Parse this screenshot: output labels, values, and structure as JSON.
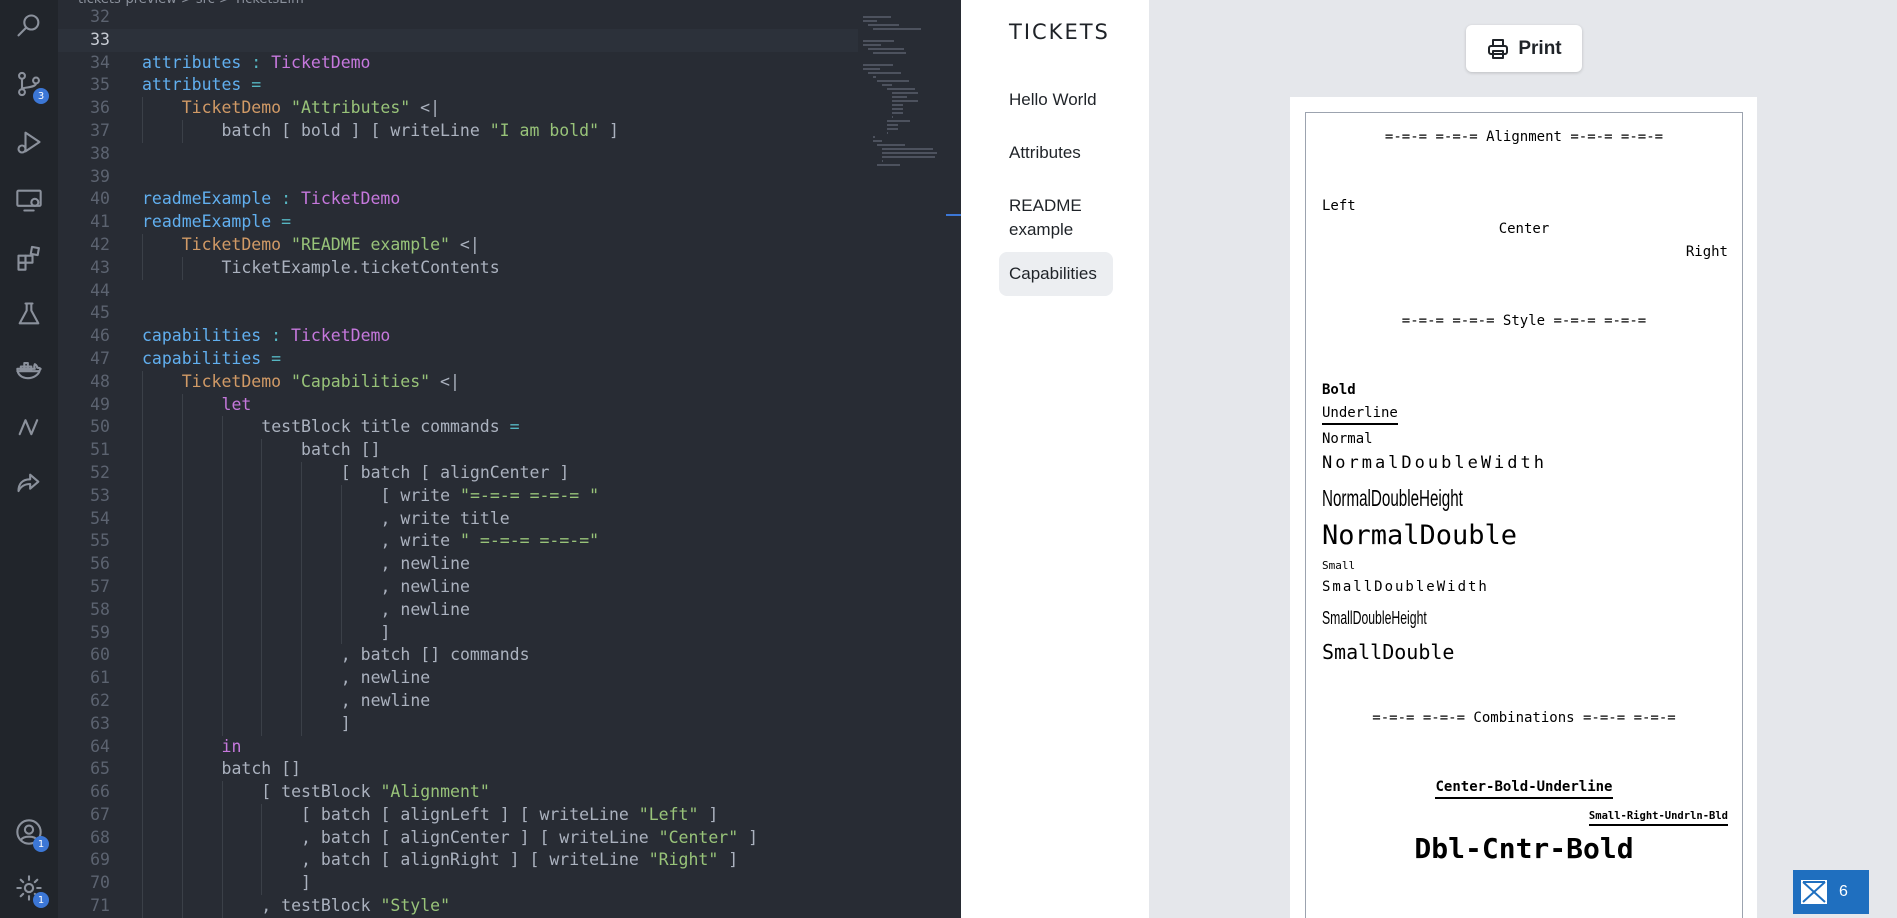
{
  "breadcrumb": "tickets-preview  >  src  >  TicketsElm",
  "activity_bar": {
    "source_control_badge": "3",
    "accounts_badge": "1",
    "settings_badge": "1"
  },
  "code_lines": [
    {
      "n": "32",
      "indent": 0,
      "tokens": []
    },
    {
      "n": "33",
      "indent": 0,
      "current": true,
      "tokens": []
    },
    {
      "n": "34",
      "indent": 0,
      "tokens": [
        [
          "fn",
          "attributes"
        ],
        [
          "op",
          " : "
        ],
        [
          "ty",
          "TicketDemo"
        ]
      ]
    },
    {
      "n": "35",
      "indent": 0,
      "tokens": [
        [
          "fn",
          "attributes"
        ],
        [
          "op",
          " ="
        ]
      ]
    },
    {
      "n": "36",
      "indent": 1,
      "tokens": [
        [
          "ctor2",
          "TicketDemo"
        ],
        [
          "pl",
          " "
        ],
        [
          "str",
          "\"Attributes\""
        ],
        [
          "pl",
          " <|"
        ]
      ]
    },
    {
      "n": "37",
      "indent": 2,
      "tokens": [
        [
          "pl",
          "batch [ bold ] [ writeLine "
        ],
        [
          "str",
          "\"I am bold\""
        ],
        [
          "pl",
          " ]"
        ]
      ]
    },
    {
      "n": "38",
      "indent": 0,
      "tokens": []
    },
    {
      "n": "39",
      "indent": 0,
      "tokens": []
    },
    {
      "n": "40",
      "indent": 0,
      "tokens": [
        [
          "fn",
          "readmeExample"
        ],
        [
          "op",
          " : "
        ],
        [
          "ty",
          "TicketDemo"
        ]
      ]
    },
    {
      "n": "41",
      "indent": 0,
      "tokens": [
        [
          "fn",
          "readmeExample"
        ],
        [
          "op",
          " ="
        ]
      ]
    },
    {
      "n": "42",
      "indent": 1,
      "tokens": [
        [
          "ctor2",
          "TicketDemo"
        ],
        [
          "pl",
          " "
        ],
        [
          "str",
          "\"README example\""
        ],
        [
          "pl",
          " <|"
        ]
      ]
    },
    {
      "n": "43",
      "indent": 2,
      "tokens": [
        [
          "pl",
          "TicketExample.ticketContents"
        ]
      ]
    },
    {
      "n": "44",
      "indent": 0,
      "tokens": []
    },
    {
      "n": "45",
      "indent": 0,
      "tokens": []
    },
    {
      "n": "46",
      "indent": 0,
      "tokens": [
        [
          "fn",
          "capabilities"
        ],
        [
          "op",
          " : "
        ],
        [
          "ty",
          "TicketDemo"
        ]
      ]
    },
    {
      "n": "47",
      "indent": 0,
      "tokens": [
        [
          "fn",
          "capabilities"
        ],
        [
          "op",
          " ="
        ]
      ]
    },
    {
      "n": "48",
      "indent": 1,
      "tokens": [
        [
          "ctor2",
          "TicketDemo"
        ],
        [
          "pl",
          " "
        ],
        [
          "str",
          "\"Capabilities\""
        ],
        [
          "pl",
          " <|"
        ]
      ]
    },
    {
      "n": "49",
      "indent": 2,
      "tokens": [
        [
          "kw",
          "let"
        ]
      ]
    },
    {
      "n": "50",
      "indent": 3,
      "tokens": [
        [
          "pl",
          "testBlock title commands "
        ],
        [
          "op",
          "="
        ]
      ]
    },
    {
      "n": "51",
      "indent": 4,
      "tokens": [
        [
          "pl",
          "batch []"
        ]
      ]
    },
    {
      "n": "52",
      "indent": 5,
      "tokens": [
        [
          "pl",
          "[ batch [ alignCenter ]"
        ]
      ]
    },
    {
      "n": "53",
      "indent": 6,
      "tokens": [
        [
          "pl",
          "[ write "
        ],
        [
          "str",
          "\"=-=-= =-=-= \""
        ]
      ]
    },
    {
      "n": "54",
      "indent": 6,
      "tokens": [
        [
          "pl",
          ", write title"
        ]
      ]
    },
    {
      "n": "55",
      "indent": 6,
      "tokens": [
        [
          "pl",
          ", write "
        ],
        [
          "str",
          "\" =-=-= =-=-=\""
        ]
      ]
    },
    {
      "n": "56",
      "indent": 6,
      "tokens": [
        [
          "pl",
          ", newline"
        ]
      ]
    },
    {
      "n": "57",
      "indent": 6,
      "tokens": [
        [
          "pl",
          ", newline"
        ]
      ]
    },
    {
      "n": "58",
      "indent": 6,
      "tokens": [
        [
          "pl",
          ", newline"
        ]
      ]
    },
    {
      "n": "59",
      "indent": 6,
      "tokens": [
        [
          "pl",
          "]"
        ]
      ]
    },
    {
      "n": "60",
      "indent": 5,
      "tokens": [
        [
          "pl",
          ", batch [] commands"
        ]
      ]
    },
    {
      "n": "61",
      "indent": 5,
      "tokens": [
        [
          "pl",
          ", newline"
        ]
      ]
    },
    {
      "n": "62",
      "indent": 5,
      "tokens": [
        [
          "pl",
          ", newline"
        ]
      ]
    },
    {
      "n": "63",
      "indent": 5,
      "tokens": [
        [
          "pl",
          "]"
        ]
      ]
    },
    {
      "n": "64",
      "indent": 2,
      "tokens": [
        [
          "kw",
          "in"
        ]
      ]
    },
    {
      "n": "65",
      "indent": 2,
      "tokens": [
        [
          "pl",
          "batch []"
        ]
      ]
    },
    {
      "n": "66",
      "indent": 3,
      "tokens": [
        [
          "pl",
          "[ testBlock "
        ],
        [
          "str",
          "\"Alignment\""
        ]
      ]
    },
    {
      "n": "67",
      "indent": 4,
      "tokens": [
        [
          "pl",
          "[ batch [ alignLeft ] [ writeLine "
        ],
        [
          "str",
          "\"Left\""
        ],
        [
          "pl",
          " ]"
        ]
      ]
    },
    {
      "n": "68",
      "indent": 4,
      "tokens": [
        [
          "pl",
          ", batch [ alignCenter ] [ writeLine "
        ],
        [
          "str",
          "\"Center\""
        ],
        [
          "pl",
          " ]"
        ]
      ]
    },
    {
      "n": "69",
      "indent": 4,
      "tokens": [
        [
          "pl",
          ", batch [ alignRight ] [ writeLine "
        ],
        [
          "str",
          "\"Right\""
        ],
        [
          "pl",
          " ]"
        ]
      ]
    },
    {
      "n": "70",
      "indent": 4,
      "tokens": [
        [
          "pl",
          "]"
        ]
      ]
    },
    {
      "n": "71",
      "indent": 3,
      "tokens": [
        [
          "pl",
          ", testBlock "
        ],
        [
          "str",
          "\"Style\""
        ]
      ]
    }
  ],
  "nav": {
    "title": "TICKETS",
    "items": [
      "Hello World",
      "Attributes",
      "README example",
      "Capabilities"
    ],
    "active_index": 3
  },
  "preview": {
    "print_label": "Print",
    "ticket": {
      "alignment_header": "=-=-= =-=-= Alignment =-=-= =-=-=",
      "left": "Left",
      "center": "Center",
      "right": "Right",
      "style_header": "=-=-= =-=-= Style =-=-= =-=-=",
      "bold": "Bold",
      "underline": "Underline",
      "normal": "Normal",
      "normal_double_width": "NormalDoubleWidth",
      "normal_double_height": "NormalDoubleHeight",
      "normal_double": "NormalDouble",
      "small": "Small",
      "small_double_width": "SmallDoubleWidth",
      "small_double_height": "SmallDoubleHeight",
      "small_double": "SmallDouble",
      "combinations_header": "=-=-= =-=-= Combinations =-=-= =-=-=",
      "center_bold_underline": "Center-Bold-Underline",
      "small_right_underline_bold": "Small-Right-Undrln-Bld",
      "dbl_cntr_bold": "Dbl-Cntr-Bold"
    }
  },
  "feedback_badge": "6"
}
